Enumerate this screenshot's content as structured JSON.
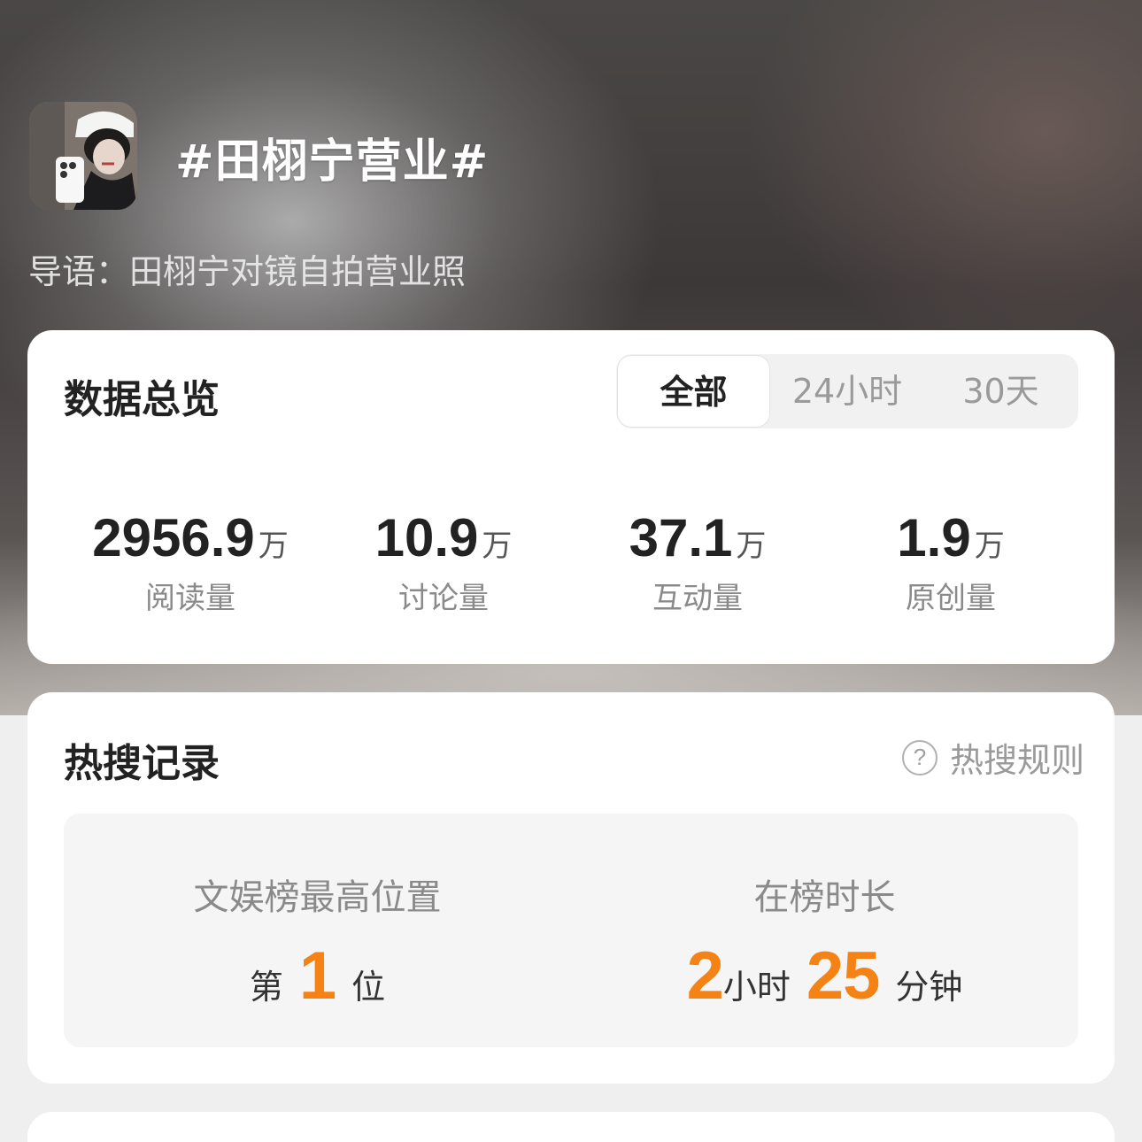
{
  "header": {
    "topic": "#田栩宁营业#",
    "intro": "导语：田栩宁对镜自拍营业照"
  },
  "overview": {
    "title": "数据总览",
    "tabs": [
      "全部",
      "24小时",
      "30天"
    ],
    "active_tab": "全部",
    "stats": [
      {
        "value": "2956.9",
        "unit": "万",
        "label": "阅读量"
      },
      {
        "value": "10.9",
        "unit": "万",
        "label": "讨论量"
      },
      {
        "value": "37.1",
        "unit": "万",
        "label": "互动量"
      },
      {
        "value": "1.9",
        "unit": "万",
        "label": "原创量"
      }
    ]
  },
  "hot_search": {
    "title": "热搜记录",
    "rules_label": "热搜规则",
    "rules_icon": "question-circle-icon",
    "best_position": {
      "label": "文娱榜最高位置",
      "prefix": "第",
      "value": "1",
      "suffix": "位"
    },
    "duration": {
      "label": "在榜时长",
      "hours": "2",
      "hours_unit": "小时",
      "minutes": "25",
      "minutes_unit": "分钟"
    }
  },
  "colors": {
    "accent": "#f58214",
    "card_bg": "#ffffff",
    "page_bg": "#efefef"
  }
}
